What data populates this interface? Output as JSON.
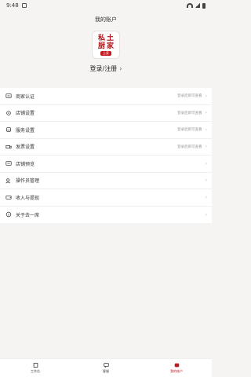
{
  "status_bar": {
    "time": "9:48"
  },
  "header": {
    "title": "我的账户",
    "logo_chars": [
      "私",
      "土",
      "厨",
      "家"
    ],
    "logo_tag": "土家",
    "login_label": "登录/注册"
  },
  "menu": {
    "items": [
      {
        "icon": "storefront-id-icon",
        "label": "商家认证",
        "hint": "登录后即可查看"
      },
      {
        "icon": "store-settings-icon",
        "label": "店铺设置",
        "hint": "登录后即可查看"
      },
      {
        "icon": "service-settings-icon",
        "label": "服务设置",
        "hint": "登录后即可查看"
      },
      {
        "icon": "invoice-truck-icon",
        "label": "发票设置",
        "hint": "登录后即可查看"
      },
      {
        "icon": "store-preview-icon",
        "label": "店铺预览",
        "hint": ""
      },
      {
        "icon": "operator-icon",
        "label": "操作员管理",
        "hint": ""
      },
      {
        "icon": "wallet-icon",
        "label": "收入与提现",
        "hint": ""
      },
      {
        "icon": "info-icon",
        "label": "关于去一席",
        "hint": ""
      }
    ]
  },
  "tabbar": {
    "tabs": [
      {
        "label": "工作台",
        "icon": "workbench-icon"
      },
      {
        "label": "客服",
        "icon": "chat-icon"
      },
      {
        "label": "我的账户",
        "icon": "account-icon"
      }
    ]
  },
  "colors": {
    "accent": "#c41b22",
    "background": "#f6f4f2"
  }
}
